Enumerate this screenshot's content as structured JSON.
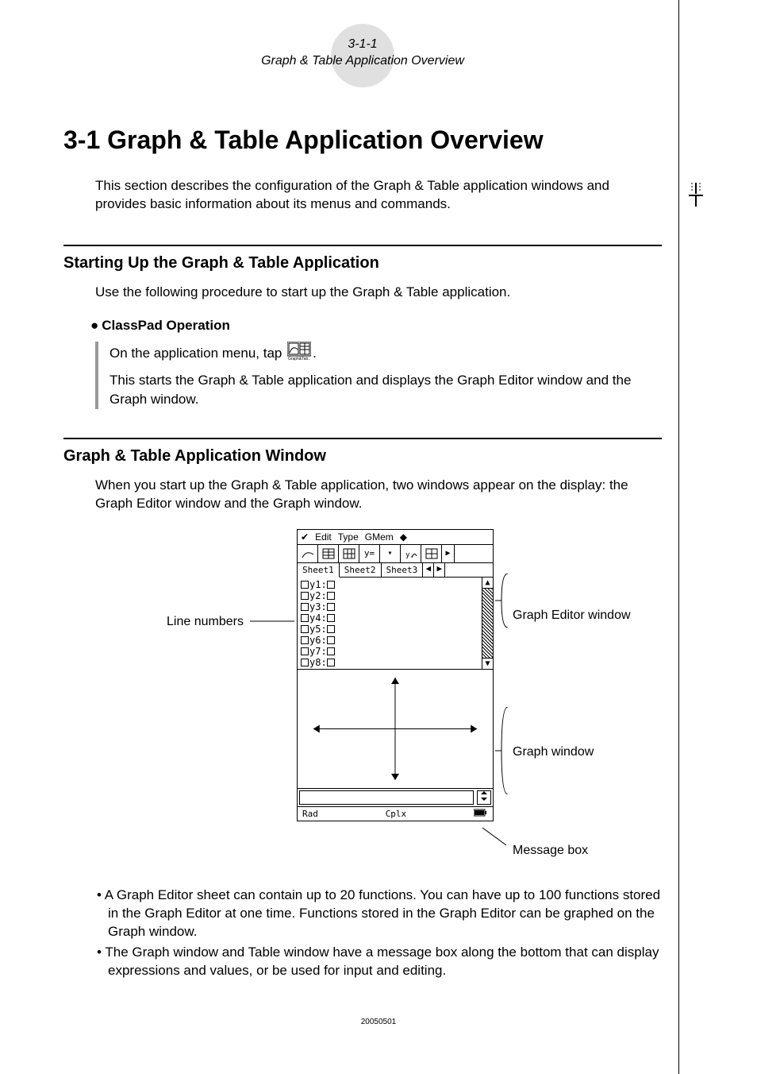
{
  "header": {
    "section_num": "3-1-1",
    "section_title": "Graph & Table Application Overview"
  },
  "h1": "3-1 Graph & Table Application Overview",
  "intro": "This section describes the configuration of the Graph & Table application windows and provides basic information about its menus and commands.",
  "startup": {
    "heading": "Starting Up the Graph & Table Application",
    "lead": "Use the following procedure to start up the Graph & Table application.",
    "sub_bullet": "●",
    "sub_head": "ClassPad Operation",
    "step1_pre": "On the application menu, tap ",
    "step1_post": ".",
    "icon_caption": "Graph&Tab..",
    "step2": "This starts the Graph & Table application and displays the Graph Editor window and the Graph window."
  },
  "appwin": {
    "heading": "Graph & Table Application Window",
    "lead": "When you start up the Graph & Table application, two windows appear on the display: the Graph Editor window and the Graph window."
  },
  "screenshot": {
    "menus": [
      "Edit",
      "Type",
      "GMem"
    ],
    "toolbar_y": "y=",
    "tabs": [
      "Sheet1",
      "Sheet2",
      "Sheet3"
    ],
    "lines": [
      "y1:",
      "y2:",
      "y3:",
      "y4:",
      "y5:",
      "y6:",
      "y7:",
      "y8:"
    ],
    "status_left": "Rad",
    "status_mid": "Cplx"
  },
  "callouts": {
    "line_numbers": "Line numbers",
    "editor": "Graph Editor window",
    "graph": "Graph window",
    "msg": "Message box"
  },
  "notes": {
    "n1": "A Graph Editor sheet can contain up to 20 functions. You can have up to 100 functions stored in the Graph Editor at one time. Functions stored in the Graph Editor can be graphed on the Graph window.",
    "n2": "The Graph window and Table window have a message box along the bottom that can display expressions and values, or be used for input and editing."
  },
  "footer_num": "20050501"
}
